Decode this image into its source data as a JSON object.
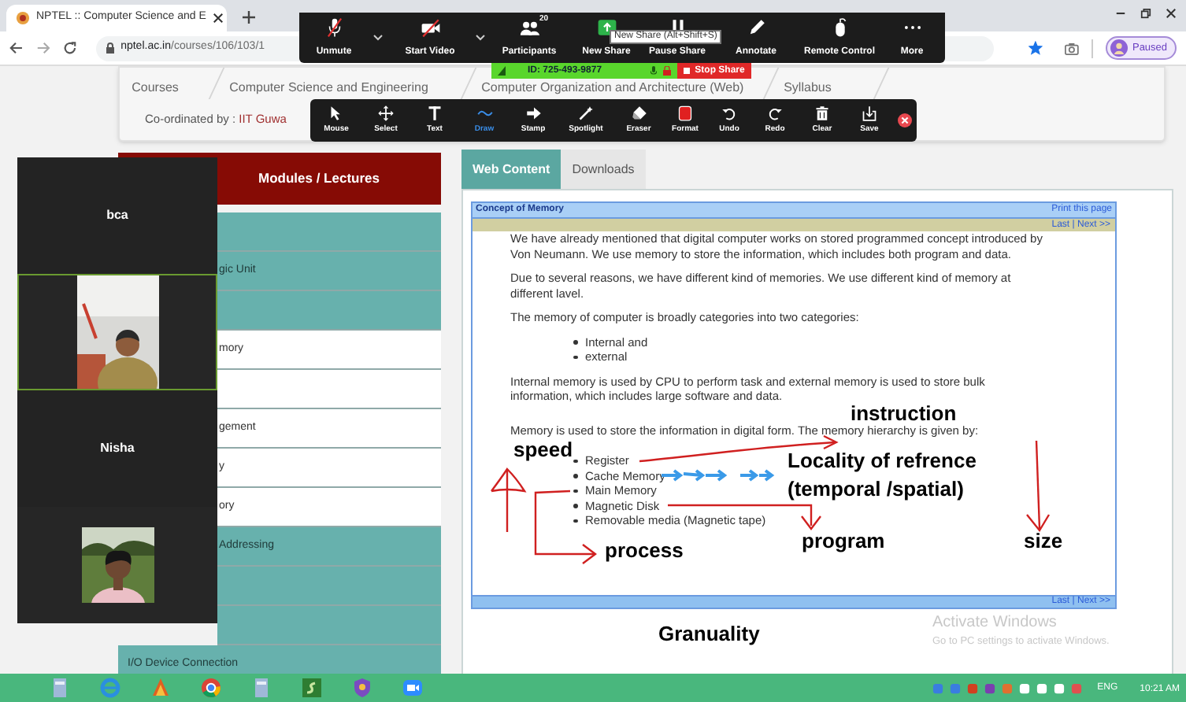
{
  "browser": {
    "tab": {
      "title": "NPTEL :: Computer Science and E"
    },
    "url": {
      "host": "nptel.ac.in",
      "path": "/courses/106/103/1"
    },
    "profile": {
      "status": "Paused"
    },
    "bookmarked": true
  },
  "breadcrumb": [
    {
      "label": "Courses"
    },
    {
      "label": "Computer Science and Engineering"
    },
    {
      "label": "Computer Organization and Architecture (Web)"
    },
    {
      "label": "Syllabus"
    }
  ],
  "coordinator": {
    "label": "Co-ordinated by : ",
    "institute": "IIT Guwa"
  },
  "modules": {
    "title": "Modules / Lectures",
    "items": [
      {
        "kind": "module"
      },
      {
        "kind": "module",
        "label": "gic Unit"
      },
      {
        "kind": "module"
      },
      {
        "kind": "lecture",
        "label": "mory"
      },
      {
        "kind": "lecture"
      },
      {
        "kind": "lecture",
        "label": "gement"
      },
      {
        "kind": "lecture",
        "label": "y"
      },
      {
        "kind": "lecture",
        "label": "ory"
      },
      {
        "kind": "module",
        "label": "Addressing"
      },
      {
        "kind": "module"
      },
      {
        "kind": "module"
      },
      {
        "kind": "module",
        "label": "I/O Device Connection"
      }
    ]
  },
  "content_tabs": [
    {
      "label": "Web Content",
      "selected": true
    },
    {
      "label": "Downloads",
      "selected": false
    }
  ],
  "lesson": {
    "title": "Concept of Memory",
    "print_link": "Print this page",
    "nav_top": "Last | Next >>",
    "nav_bottom": "Last | Next >>",
    "blocks": [
      {
        "kind": "paragraph",
        "text": "We have already mentioned that digital computer works on stored programmed concept introduced by Von Neumann. We use memory to store the information, which includes both program and data."
      },
      {
        "kind": "paragraph",
        "text": "Due to several reasons, we have different kind of memories. We use different kind of memory at different lavel."
      },
      {
        "kind": "paragraph",
        "text": "The memory of computer is broadly categories into two categories:"
      },
      {
        "kind": "list",
        "items": [
          "Internal and",
          "external"
        ]
      },
      {
        "kind": "paragraph",
        "text": "Internal memory is used by CPU to perform task and external memory is used to store bulk information, which includes large software and data."
      },
      {
        "kind": "paragraph",
        "text": "Memory is used to store the information in digital form. The memory hierarchy is given by:"
      },
      {
        "kind": "list",
        "items": [
          "Register",
          "Cache Memory",
          "Main Memory",
          "Magnetic Disk",
          "Removable media (Magnetic tape)"
        ]
      }
    ]
  },
  "annotations": [
    "instruction",
    "speed",
    "Locality of refrence",
    "(temporal /spatial)",
    "program",
    "size",
    "process",
    "Granuality"
  ],
  "video_tiles": [
    {
      "kind": "name",
      "name": "bca"
    },
    {
      "kind": "video",
      "speaking": true
    },
    {
      "kind": "name",
      "name": "Nisha"
    },
    {
      "kind": "video",
      "speaking": false
    }
  ],
  "meeting_toolbar": [
    {
      "kind": "button",
      "label": "Unmute"
    },
    {
      "kind": "caret"
    },
    {
      "kind": "button",
      "label": "Start Video"
    },
    {
      "kind": "caret"
    },
    {
      "kind": "button",
      "label": "Participants",
      "count": "20"
    },
    {
      "kind": "button",
      "label": "New Share"
    },
    {
      "kind": "button",
      "label": "Pause Share"
    },
    {
      "kind": "button",
      "label": "Annotate"
    },
    {
      "kind": "button",
      "label": "Remote Control"
    },
    {
      "kind": "button",
      "label": "More"
    }
  ],
  "tooltip": "New Share (Alt+Shift+S)",
  "share_bar": {
    "meeting_id": "ID: 725-493-9877",
    "stop_label": "Stop Share"
  },
  "annotation_tools": [
    {
      "kind": "tool",
      "label": "Mouse",
      "selected": false
    },
    {
      "kind": "tool",
      "label": "Select",
      "selected": false
    },
    {
      "kind": "tool",
      "label": "Text",
      "selected": false
    },
    {
      "kind": "tool",
      "label": "Draw",
      "selected": true
    },
    {
      "kind": "tool",
      "label": "Stamp",
      "selected": false
    },
    {
      "kind": "tool",
      "label": "Spotlight",
      "selected": false
    },
    {
      "kind": "tool",
      "label": "Eraser",
      "selected": false
    },
    {
      "kind": "tool",
      "label": "Format",
      "selected": false
    },
    {
      "kind": "tool",
      "label": "Undo",
      "selected": false
    },
    {
      "kind": "tool",
      "label": "Redo",
      "selected": false
    },
    {
      "kind": "tool",
      "label": "Clear",
      "selected": false
    },
    {
      "kind": "tool",
      "label": "Save",
      "selected": false
    },
    {
      "kind": "close"
    }
  ],
  "windows_notice": {
    "title": "Activate Windows",
    "subtitle": "Go to PC settings to activate Windows."
  },
  "taskbar": {
    "language": "ENG",
    "time": "10:21 AM"
  }
}
